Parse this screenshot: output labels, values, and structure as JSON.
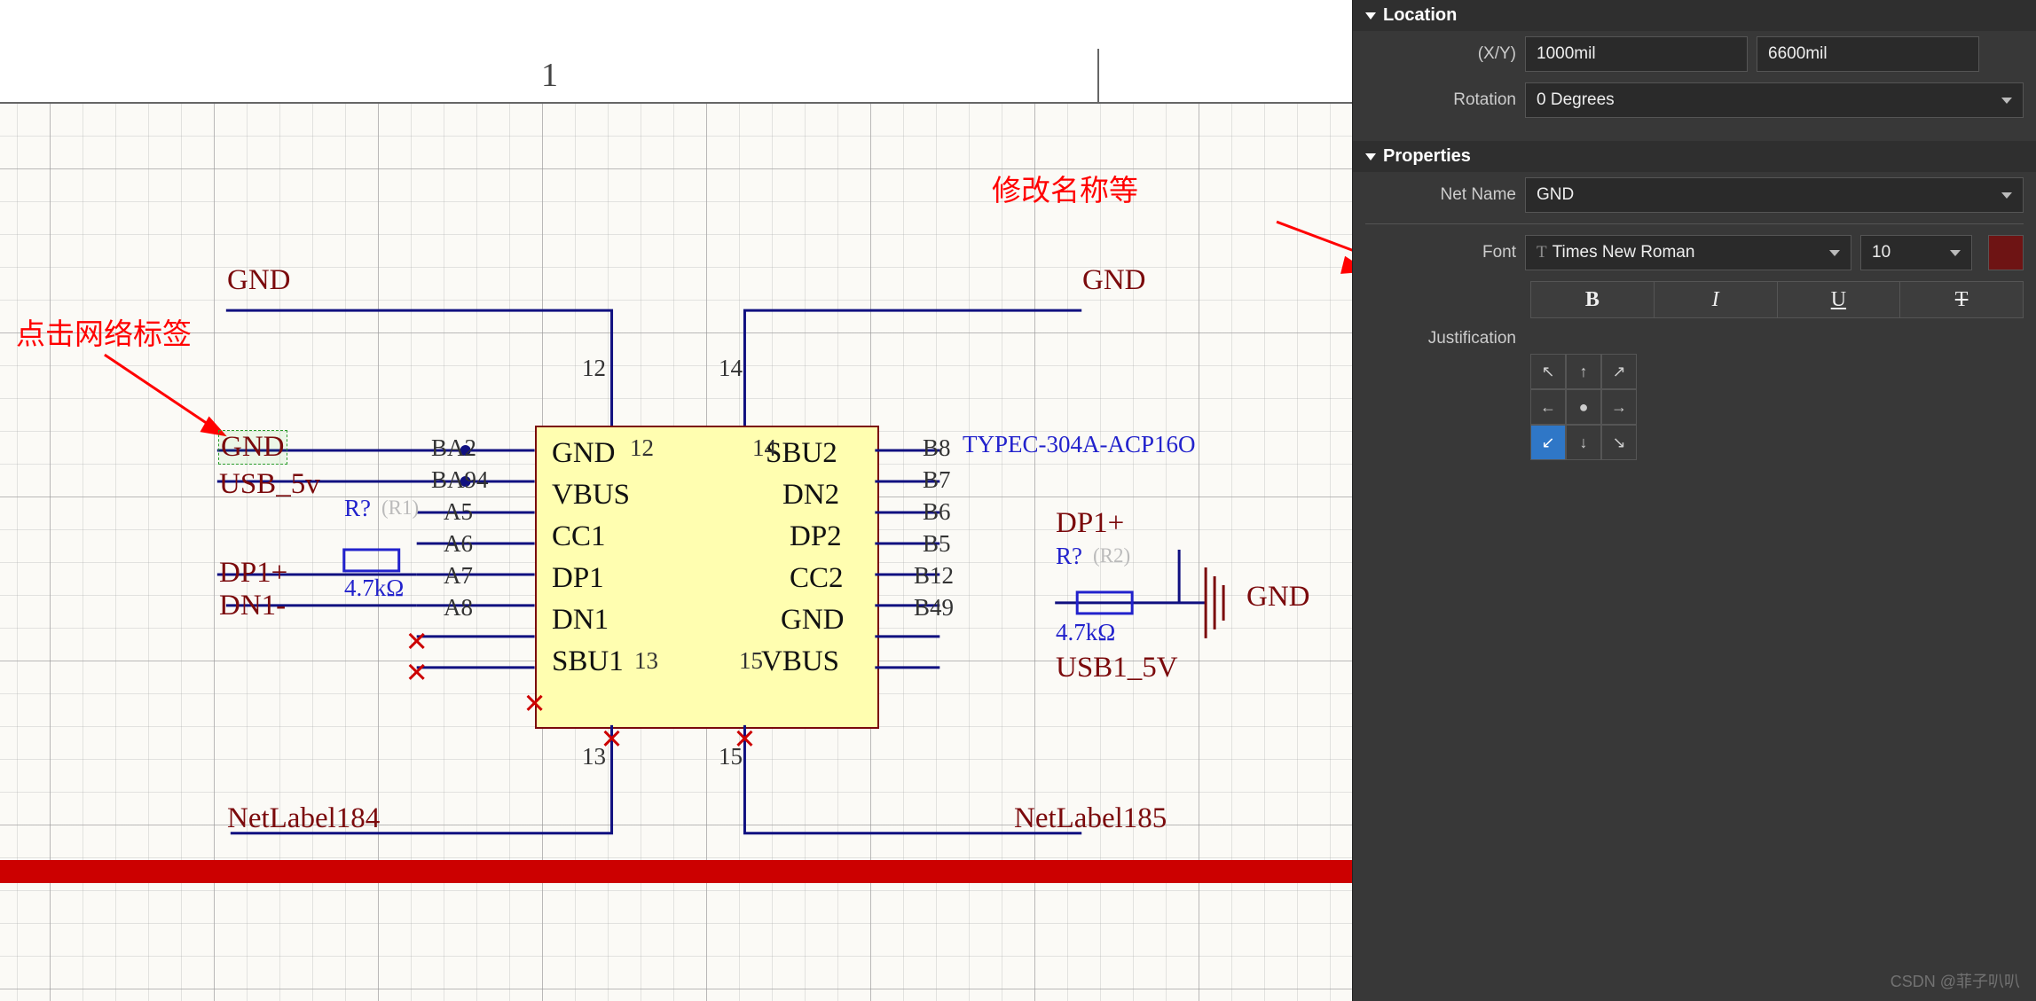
{
  "header": {
    "column_number": "1"
  },
  "annotations": {
    "click_label": "点击网络标签",
    "modify_name": "修改名称等"
  },
  "netlabels": {
    "gnd_top_left": "GND",
    "gnd_top_right": "GND",
    "gnd_selected": "GND",
    "usb_5v": "USB_5v",
    "dp1_plus": "DP1+",
    "dn1_minus": "DN1-",
    "netlabel184": "NetLabel184",
    "netlabel185": "NetLabel185",
    "dp1_plus_r": "DP1+",
    "gnd_right_sym": "GND",
    "usb1_5v": "USB1_5V",
    "typec_part": "TYPEC-304A-ACP16O"
  },
  "resistors": {
    "r1": {
      "ref": "R?",
      "alt": "(R1)",
      "value": "4.7kΩ"
    },
    "r2": {
      "ref": "R?",
      "alt": "(R2)",
      "value": "4.7kΩ"
    }
  },
  "ic": {
    "left_pins_inner": [
      "GND",
      "VBUS",
      "CC1",
      "DP1",
      "DN1",
      "SBU1"
    ],
    "right_pins_inner": [
      "SBU2",
      "DN2",
      "DP2",
      "CC2",
      "GND",
      "VBUS"
    ],
    "left_designators": [
      "BA2",
      "BA94",
      "A5",
      "A6",
      "A7",
      "A8"
    ],
    "right_designators": [
      "B8",
      "B7",
      "B6",
      "B5",
      "B12",
      "B49"
    ],
    "top_designators": [
      "12",
      "14"
    ],
    "bottom_designators": [
      "13",
      "15"
    ],
    "inner_top": [
      "12",
      "14"
    ],
    "inner_bottom": [
      "13",
      "15"
    ]
  },
  "panel": {
    "sections": {
      "location": "Location",
      "properties": "Properties"
    },
    "location": {
      "xy_label": "(X/Y)",
      "x": "1000mil",
      "y": "6600mil",
      "rotation_label": "Rotation",
      "rotation": "0 Degrees"
    },
    "properties": {
      "netname_label": "Net Name",
      "netname": "GND",
      "font_label": "Font",
      "font_family": "Times New Roman",
      "font_size": "10",
      "bold": "B",
      "italic": "I",
      "underline": "U",
      "strike": "T",
      "justification_label": "Justification"
    }
  },
  "watermark": "CSDN @菲子叭叭"
}
